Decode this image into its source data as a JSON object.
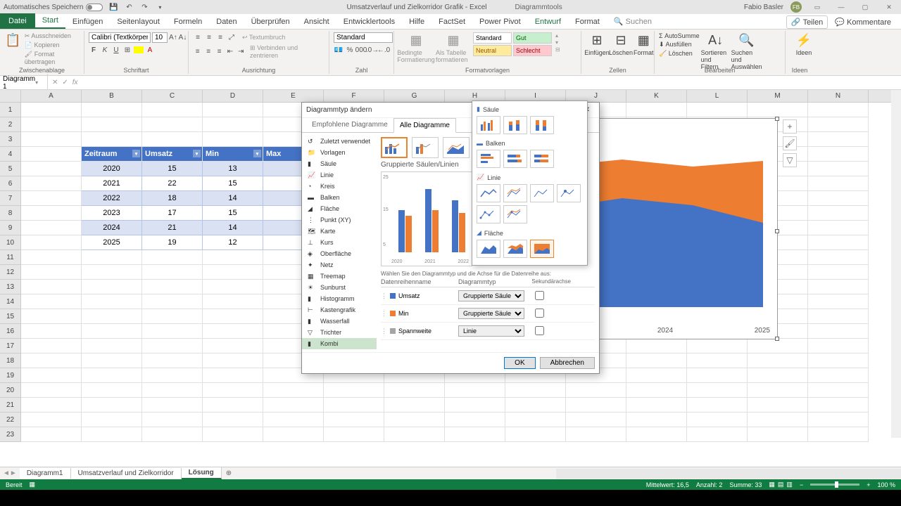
{
  "title": {
    "autosave": "Automatisches Speichern",
    "doc": "Umsatzverlauf und Zielkorridor Grafik - Excel",
    "tools": "Diagrammtools",
    "user": "Fabio Basler",
    "user_initials": "FB"
  },
  "ribbon_tabs": {
    "file": "Datei",
    "start": "Start",
    "einfuegen": "Einfügen",
    "seitenlayout": "Seitenlayout",
    "formeln": "Formeln",
    "daten": "Daten",
    "ueberpruefen": "Überprüfen",
    "ansicht": "Ansicht",
    "entwicklertools": "Entwicklertools",
    "hilfe": "Hilfe",
    "factset": "FactSet",
    "powerpivot": "Power Pivot",
    "entwurf": "Entwurf",
    "format": "Format",
    "suchen": "Suchen",
    "teilen": "Teilen",
    "kommentare": "Kommentare"
  },
  "ribbon": {
    "clipboard": {
      "ausschneiden": "Ausschneiden",
      "kopieren": "Kopieren",
      "format_uebertragen": "Format übertragen",
      "label": "Zwischenablage"
    },
    "font": {
      "name": "Calibri (Textkörper)",
      "size": "10",
      "label": "Schriftart"
    },
    "align": {
      "textumbruch": "Textumbruch",
      "verbinden": "Verbinden und zentrieren",
      "label": "Ausrichtung"
    },
    "number": {
      "format": "Standard",
      "label": "Zahl"
    },
    "cond": {
      "bedingte": "Bedingte Formatierung",
      "tabelle": "Als Tabelle formatieren",
      "vorlagen": "Formatvorlagen"
    },
    "styles": {
      "standard": "Standard",
      "gut": "Gut",
      "neutral": "Neutral",
      "schlecht": "Schlecht"
    },
    "cells": {
      "einfuegen": "Einfügen",
      "loeschen": "Löschen",
      "format": "Format",
      "label": "Zellen"
    },
    "editing": {
      "autosumme": "AutoSumme",
      "ausfuellen": "Ausfüllen",
      "loeschen": "Löschen",
      "sortieren": "Sortieren und Filtern",
      "suchen": "Suchen und Auswählen",
      "label": "Bearbeiten"
    },
    "ideas": {
      "ideen": "Ideen",
      "label": "Ideen"
    }
  },
  "name_box": "Diagramm 1",
  "columns": [
    "A",
    "B",
    "C",
    "D",
    "E",
    "F",
    "G",
    "H",
    "I",
    "J",
    "K",
    "L",
    "M",
    "N"
  ],
  "table": {
    "headers": {
      "zeitraum": "Zeitraum",
      "umsatz": "Umsatz",
      "min": "Min",
      "max": "Max"
    },
    "rows": [
      {
        "z": "2020",
        "u": "15",
        "mi": "13"
      },
      {
        "z": "2021",
        "u": "22",
        "mi": "15"
      },
      {
        "z": "2022",
        "u": "18",
        "mi": "14"
      },
      {
        "z": "2023",
        "u": "17",
        "mi": "15"
      },
      {
        "z": "2024",
        "u": "21",
        "mi": "14"
      },
      {
        "z": "2025",
        "u": "19",
        "mi": "12"
      }
    ]
  },
  "dialog": {
    "title": "Diagrammtyp ändern",
    "tab1": "Empfohlene Diagramme",
    "tab2": "Alle Diagramme",
    "types": {
      "zuletzt": "Zuletzt verwendet",
      "vorlagen": "Vorlagen",
      "saule": "Säule",
      "linie": "Linie",
      "kreis": "Kreis",
      "balken": "Balken",
      "flache": "Fläche",
      "punkt": "Punkt (XY)",
      "karte": "Karte",
      "kurs": "Kurs",
      "oberflache": "Oberfläche",
      "netz": "Netz",
      "treemap": "Treemap",
      "sunburst": "Sunburst",
      "histogramm": "Histogramm",
      "kastengrafik": "Kastengrafik",
      "wasserfall": "Wasserfall",
      "trichter": "Trichter",
      "kombi": "Kombi"
    },
    "preview_title": "Gruppierte Säulen/Linien",
    "combo_label": "Wählen Sie den Diagrammtyp und die Achse für die Datenreihe aus:",
    "col_name": "Datenreihenname",
    "col_type": "Diagrammtyp",
    "col_axis": "Sekundärachse",
    "series": {
      "umsatz": {
        "name": "Umsatz",
        "type": "Gruppierte Säulen"
      },
      "min": {
        "name": "Min",
        "type": "Gruppierte Säulen"
      },
      "spannweite": {
        "name": "Spannweite",
        "type": "Linie"
      }
    },
    "ok": "OK",
    "cancel": "Abbrechen"
  },
  "gallery": {
    "saule": "Säule",
    "balken": "Balken",
    "linie": "Linie",
    "flache": "Fläche"
  },
  "sheets": {
    "s1": "Diagramm1",
    "s2": "Umsatzverlauf und Zielkorridor",
    "s3": "Lösung"
  },
  "status": {
    "bereit": "Bereit",
    "mittelwert": "Mittelwert: 16,5",
    "anzahl": "Anzahl: 2",
    "summe": "Summe: 33",
    "zoom": "100 %"
  },
  "chart_xlabels": {
    "x1": "2023",
    "x2": "2024",
    "x3": "2025"
  },
  "preview_axis": {
    "y25": "25",
    "y15": "15",
    "y5": "5",
    "x1": "2020",
    "x2": "2021",
    "x3": "2022"
  },
  "chart_data": {
    "type": "area",
    "title": "",
    "categories": [
      "2020",
      "2021",
      "2022",
      "2023",
      "2024",
      "2025"
    ],
    "series": [
      {
        "name": "Max",
        "values": [
          18,
          20,
          20,
          18,
          20,
          19
        ],
        "color": "#ed7d31"
      },
      {
        "name": "Min",
        "values": [
          13,
          15,
          14,
          15,
          14,
          12
        ],
        "color": "#4472c4"
      }
    ],
    "xlabel": "",
    "ylabel": "",
    "ylim": [
      0,
      25
    ]
  }
}
